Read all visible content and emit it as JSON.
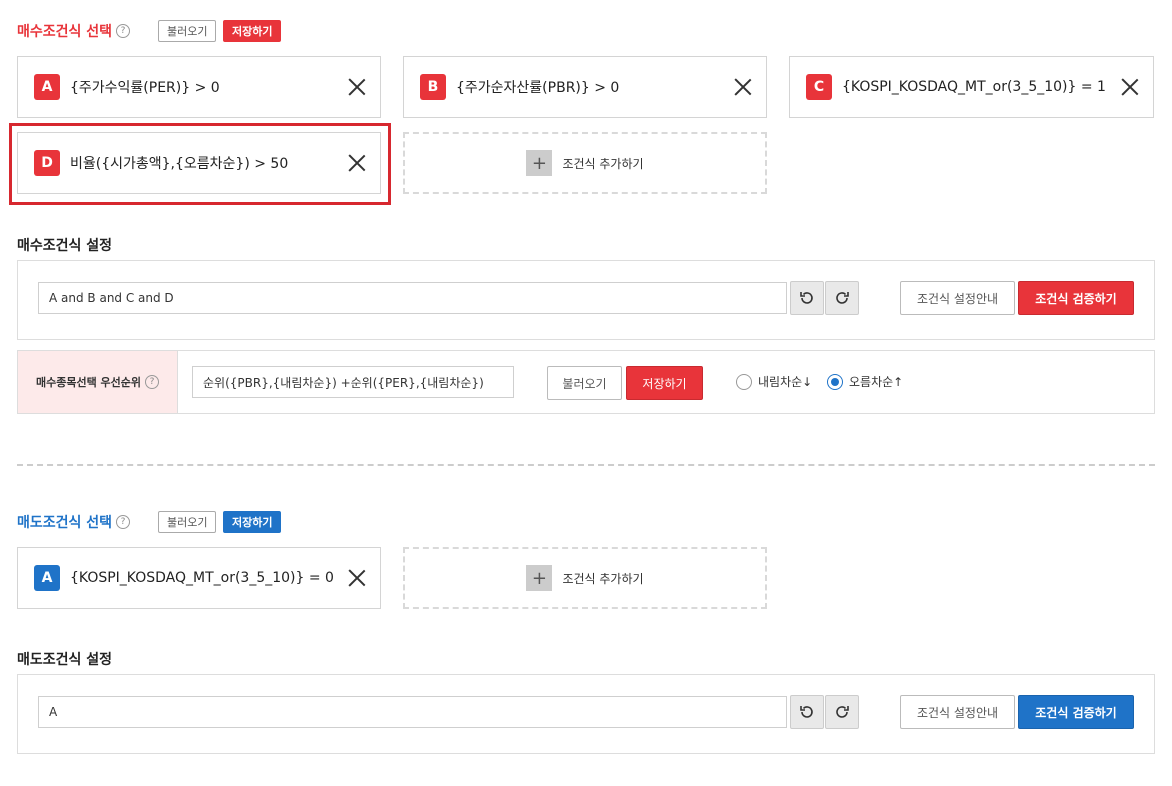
{
  "buy": {
    "title": "매수조건식 선택",
    "load_label": "불러오기",
    "save_label": "저장하기",
    "conditions": [
      {
        "letter": "A",
        "text": "{주가수익률(PER)} > 0"
      },
      {
        "letter": "B",
        "text": "{주가순자산률(PBR)} > 0"
      },
      {
        "letter": "C",
        "text": "{KOSPI_KOSDAQ_MT_or(3_5_10)} = 1"
      },
      {
        "letter": "D",
        "text": "비율({시가총액},{오름차순}) > 50"
      }
    ],
    "add_label": "조건식 추가하기",
    "setting_title": "매수조건식 설정",
    "formula": "A and B and C and D",
    "guide_label": "조건식 설정안내",
    "verify_label": "조건식 검증하기",
    "priority": {
      "label": "매수종목선택 우선순위",
      "formula": "순위({PBR},{내림차순}) +순위({PER},{내림차순})",
      "load_label": "불러오기",
      "save_label": "저장하기",
      "desc_label": "내림차순↓",
      "asc_label": "오름차순↑",
      "selected": "asc"
    }
  },
  "sell": {
    "title": "매도조건식 선택",
    "load_label": "불러오기",
    "save_label": "저장하기",
    "conditions": [
      {
        "letter": "A",
        "text": "{KOSPI_KOSDAQ_MT_or(3_5_10)} = 0"
      }
    ],
    "add_label": "조건식 추가하기",
    "setting_title": "매도조건식 설정",
    "formula": "A",
    "guide_label": "조건식 설정안내",
    "verify_label": "조건식 검증하기"
  },
  "help_glyph": "?",
  "plus_glyph": "+",
  "colors": {
    "buy_accent": "#e8343a",
    "sell_accent": "#1f73c8",
    "highlight": "#d7282f"
  }
}
